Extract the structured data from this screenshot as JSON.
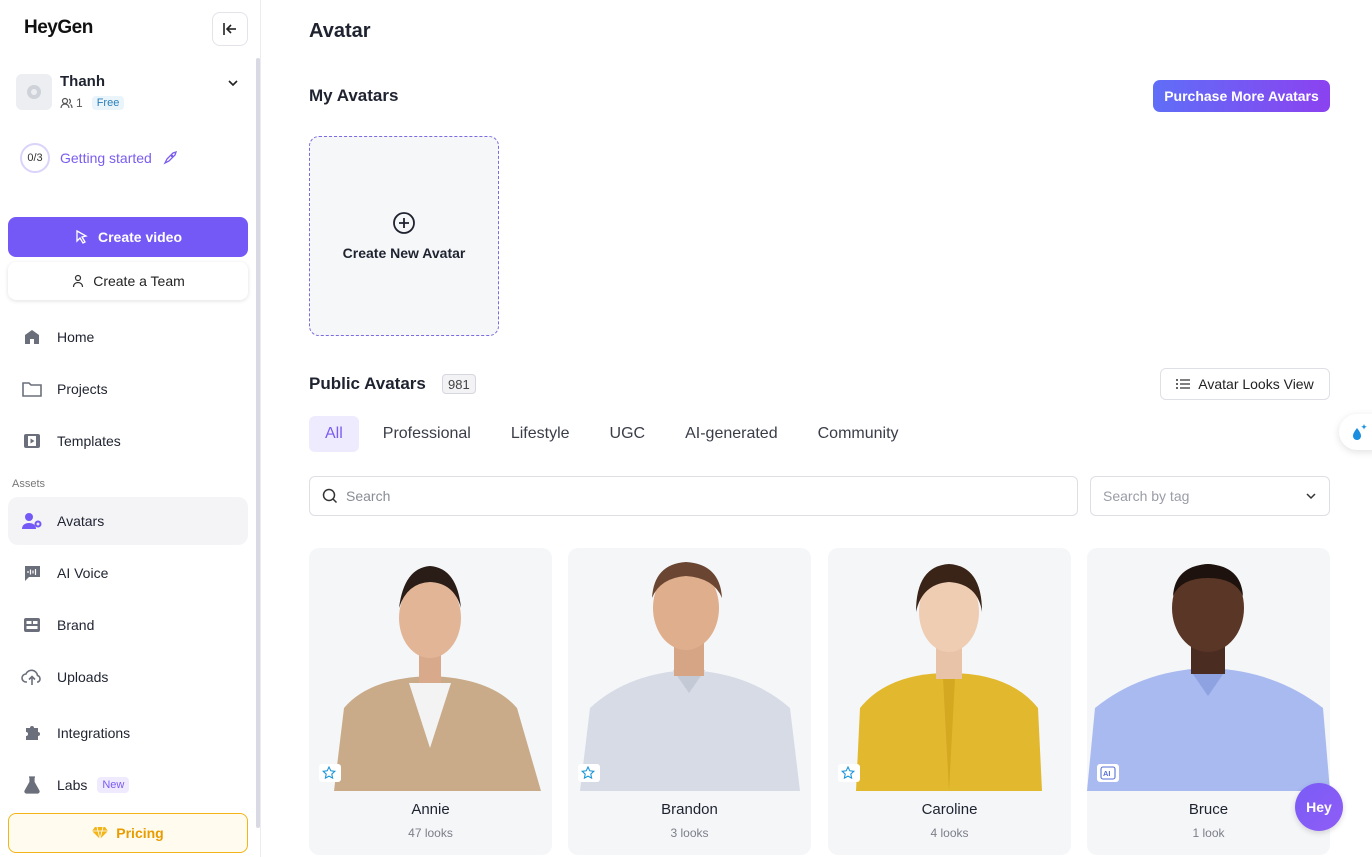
{
  "app": {
    "logo_text": "HeyGen"
  },
  "workspace": {
    "name": "Thanh",
    "members": "1",
    "plan": "Free"
  },
  "getting_started": {
    "progress": "0/3",
    "label": "Getting started"
  },
  "sidebar": {
    "create_video_label": "Create video",
    "create_team_label": "Create a Team",
    "items": [
      {
        "label": "Home",
        "icon": "home-icon"
      },
      {
        "label": "Projects",
        "icon": "folder-icon"
      },
      {
        "label": "Templates",
        "icon": "film-icon"
      }
    ],
    "assets_section_label": "Assets",
    "asset_items": [
      {
        "label": "Avatars",
        "icon": "avatar-icon",
        "active": true
      },
      {
        "label": "AI Voice",
        "icon": "voice-icon"
      },
      {
        "label": "Brand",
        "icon": "brand-icon"
      },
      {
        "label": "Uploads",
        "icon": "upload-cloud-icon"
      },
      {
        "label": "Integrations",
        "icon": "puzzle-icon"
      },
      {
        "label": "Labs",
        "icon": "flask-icon",
        "badge": "New"
      }
    ],
    "pricing_label": "Pricing"
  },
  "main": {
    "page_title": "Avatar",
    "my_avatars_title": "My Avatars",
    "purchase_label": "Purchase More Avatars",
    "create_new_avatar_label": "Create New Avatar",
    "public_avatars_title": "Public Avatars",
    "public_avatars_count": "981",
    "looks_view_label": "Avatar Looks View",
    "tabs": [
      {
        "label": "All",
        "active": true
      },
      {
        "label": "Professional"
      },
      {
        "label": "Lifestyle"
      },
      {
        "label": "UGC"
      },
      {
        "label": "AI-generated"
      },
      {
        "label": "Community"
      }
    ],
    "search_placeholder": "Search",
    "tag_search_placeholder": "Search by tag",
    "avatars": [
      {
        "name": "Annie",
        "looks": "47 looks",
        "tag_icon": "sparkle-star-icon"
      },
      {
        "name": "Brandon",
        "looks": "3 looks",
        "tag_icon": "sparkle-star-icon"
      },
      {
        "name": "Caroline",
        "looks": "4 looks",
        "tag_icon": "sparkle-star-icon"
      },
      {
        "name": "Bruce",
        "looks": "1 look",
        "tag_icon": "ai-badge-icon"
      }
    ],
    "fab_label": "Hey"
  },
  "colors": {
    "primary": "#7559f6",
    "pricing_accent": "#f2b416",
    "free_badge": "#2b7fb8"
  }
}
